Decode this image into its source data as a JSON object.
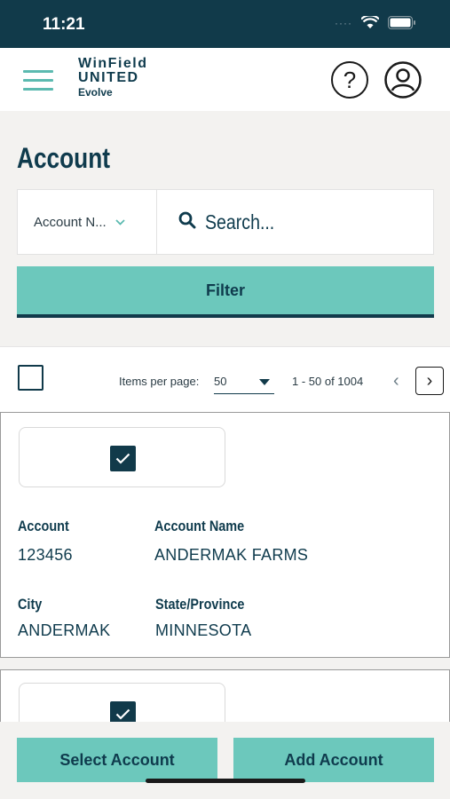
{
  "status_bar": {
    "time": "11:21",
    "signal": "····"
  },
  "header": {
    "logo_line1": "WinField",
    "logo_line2": "UNITED",
    "logo_sub": "Evolve",
    "help_symbol": "?"
  },
  "page": {
    "title": "Account"
  },
  "search": {
    "type_label": "Account N...",
    "placeholder": "Search..."
  },
  "filter": {
    "label": "Filter"
  },
  "pager": {
    "items_per_page_label": "Items per page:",
    "items_per_page_value": "50",
    "range": "1 - 50 of 1004",
    "prev": "‹",
    "next": "›"
  },
  "cards": [
    {
      "checked": true,
      "account_label": "Account",
      "account_value": "123456",
      "name_label": "Account Name",
      "name_value": "ANDERMAK FARMS",
      "city_label": "City",
      "city_value": "ANDERMAK",
      "state_label": "State/Province",
      "state_value": "MINNESOTA"
    },
    {
      "checked": true
    }
  ],
  "actions": {
    "select_label": "Select Account",
    "add_label": "Add Account"
  },
  "colors": {
    "primary": "#113a4a",
    "accent": "#6cc8bc",
    "background": "#f3f2f0"
  },
  "icons": [
    "menu-icon",
    "help-icon",
    "user-icon",
    "search-icon",
    "chevron-down-icon",
    "check-icon",
    "wifi-icon",
    "battery-icon"
  ]
}
